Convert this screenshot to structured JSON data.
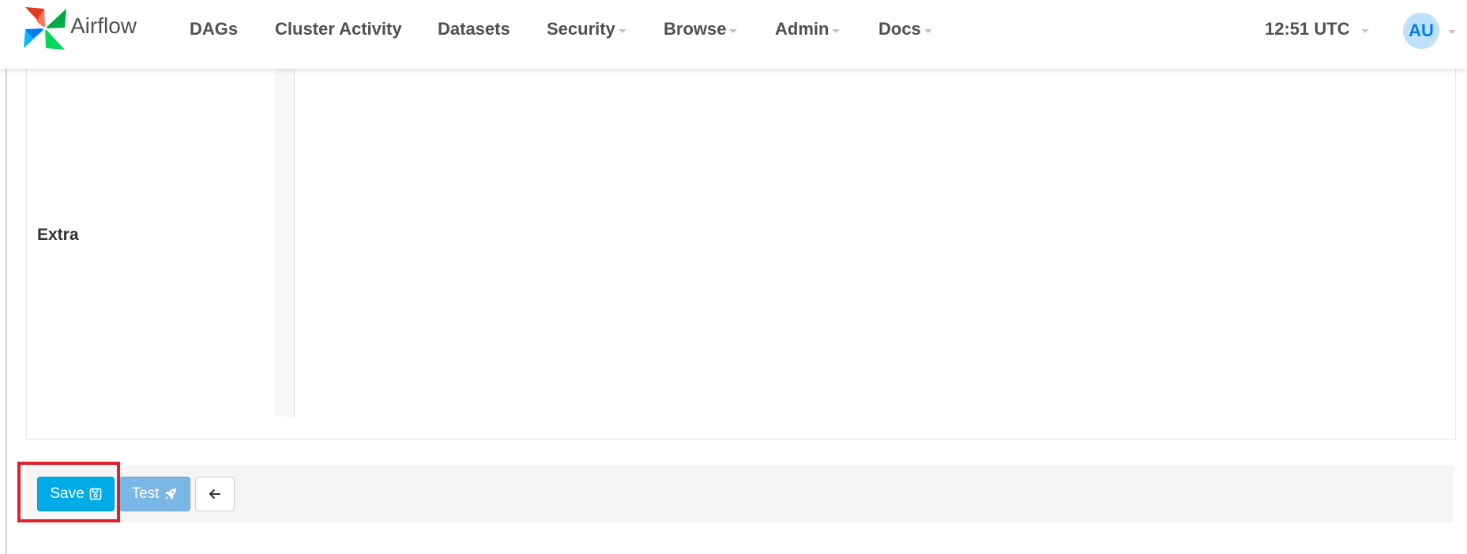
{
  "brand": {
    "name": "Airflow",
    "logo_icon": "pinwheel-logo-icon"
  },
  "nav": {
    "items": [
      {
        "label": "DAGs",
        "has_dropdown": false
      },
      {
        "label": "Cluster Activity",
        "has_dropdown": false
      },
      {
        "label": "Datasets",
        "has_dropdown": false
      },
      {
        "label": "Security",
        "has_dropdown": true
      },
      {
        "label": "Browse",
        "has_dropdown": true
      },
      {
        "label": "Admin",
        "has_dropdown": true
      },
      {
        "label": "Docs",
        "has_dropdown": true
      }
    ],
    "time": "12:51 UTC",
    "user_initials": "AU"
  },
  "form": {
    "extra_label": "Extra",
    "extra_value": ""
  },
  "actions": {
    "save_label": "Save",
    "save_icon": "floppy-disk-icon",
    "test_label": "Test",
    "test_icon": "rocket-icon",
    "back_icon": "arrow-left-icon"
  },
  "colors": {
    "save_button": "#00ace6",
    "test_button": "#7bb7e6",
    "highlight": "#e0202a",
    "avatar_bg": "#bee0f8",
    "avatar_text": "#017cee"
  }
}
